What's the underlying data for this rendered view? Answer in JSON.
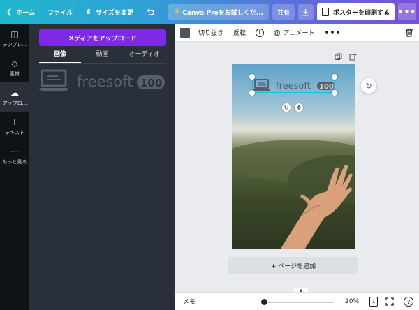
{
  "topbar": {
    "home": "ホーム",
    "file": "ファイル",
    "resize": "サイズを変更",
    "trial": "Canva Proをお試しくだ...",
    "share": "共有",
    "print": "ポスターを印刷する"
  },
  "rail": {
    "items": [
      {
        "label": "テンプレ..."
      },
      {
        "label": "素材"
      },
      {
        "label": "アップロ..."
      },
      {
        "label": "テキスト"
      },
      {
        "label": "もっと見る"
      }
    ]
  },
  "panel": {
    "upload_label": "メディアをアップロード",
    "tabs": [
      {
        "label": "画像"
      },
      {
        "label": "動画"
      },
      {
        "label": "オーディオ"
      }
    ],
    "thumb_logo_text": "freesoft",
    "thumb_logo_num": "100"
  },
  "toolbar": {
    "crop": "切り抜き",
    "flip": "反転",
    "animate": "アニメート"
  },
  "canvas": {
    "logo_text": "freesoft",
    "logo_num": "100",
    "add_page": "+ ページを追加"
  },
  "bottombar": {
    "memo": "メモ",
    "zoom": "20%",
    "zoom_fraction": 0.0,
    "page_count": "1"
  },
  "colors": {
    "accent": "#7d2ae8",
    "selection": "#13c4d8",
    "panel_bg": "#293039",
    "rail_bg": "#0e1318"
  }
}
